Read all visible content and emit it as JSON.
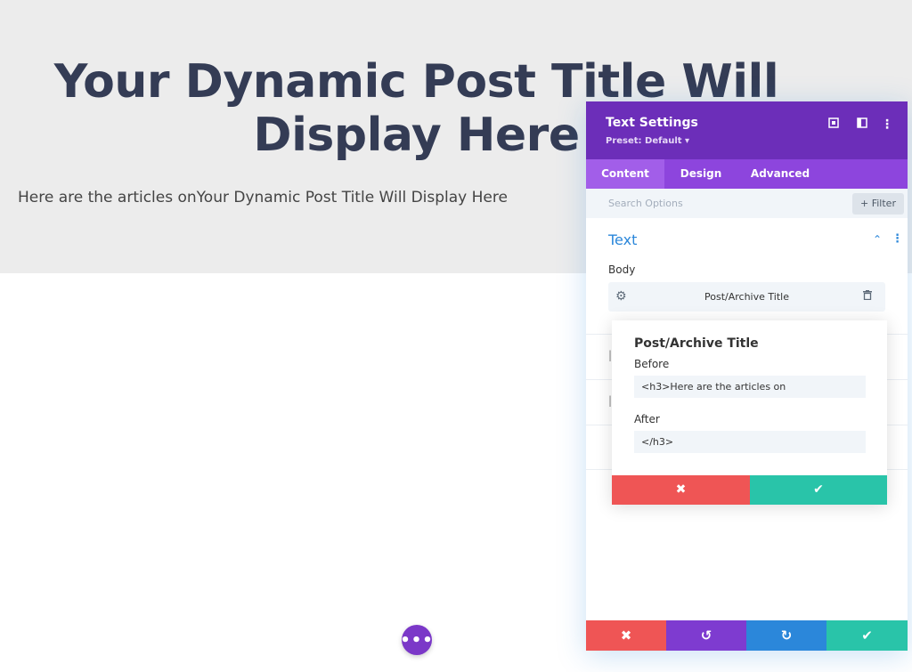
{
  "hero": {
    "title": "Your Dynamic Post Title Will Display Here",
    "subtitle": "Here are the articles onYour Dynamic Post Title Will Display Here"
  },
  "fab": {
    "icon": "more-dots-icon",
    "label": "•••"
  },
  "panel": {
    "title": "Text Settings",
    "preset": "Preset: Default ▾",
    "icons": {
      "responsive": "expand-icon",
      "layout": "sidebar-icon",
      "menu": "kebab-icon"
    },
    "tabs": [
      {
        "label": "Content",
        "active": true
      },
      {
        "label": "Design",
        "active": false
      },
      {
        "label": "Advanced",
        "active": false
      }
    ],
    "search": {
      "placeholder": "Search Options",
      "filter_label": "+ Filter"
    },
    "section": {
      "title": "Text"
    },
    "body_label": "Body",
    "dynamic_field": {
      "label": "Post/Archive Title"
    }
  },
  "popup": {
    "title": "Post/Archive Title",
    "before_label": "Before",
    "before_value": "<h3>Here are the articles on",
    "after_label": "After",
    "after_value": "</h3>",
    "cancel_icon": "✖",
    "confirm_icon": "✔"
  },
  "footer": {
    "cancel_icon": "✖",
    "undo_icon": "↺",
    "redo_icon": "↻",
    "save_icon": "✔"
  },
  "colors": {
    "header": "#6c2eb9",
    "tabs": "#8d45dd",
    "accent": "#2b87da",
    "cancel": "#ef5555",
    "save": "#29c4a9"
  }
}
